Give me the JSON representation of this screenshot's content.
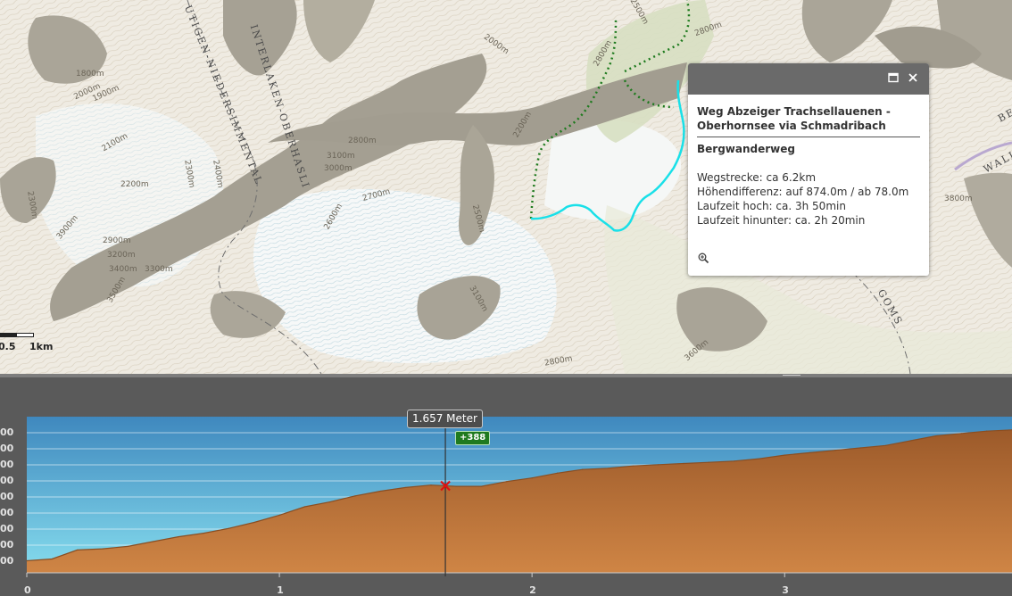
{
  "map": {
    "elevation_labels": [
      "1800m",
      "1900m",
      "2000m",
      "2100m",
      "2200m",
      "2300m",
      "2400m",
      "2600m",
      "2700m",
      "2800m",
      "2900m",
      "3000m",
      "3100m",
      "3200m",
      "3300m",
      "3400m",
      "3500m",
      "3600m",
      "3800m",
      "2800m",
      "2000m",
      "2200m",
      "2500m",
      "3100m",
      "2800m",
      "2500m",
      "2800m",
      "2300m",
      "3900m"
    ],
    "region_labels": {
      "niedersimmental": "UTIGEN-NIEDERSIMMENTAL",
      "oberhasli": "INTERLAKEN-OBERHASLI",
      "wallis": "WALLIS",
      "goms": "GOMS",
      "be": "BE"
    },
    "scalebar": {
      "label_left": "0.5",
      "label_right": "1km"
    },
    "colors": {
      "route_hike": "#19e0e8",
      "route_path": "#1d7a1d",
      "rock": "#a49f92"
    }
  },
  "popup": {
    "title": "Weg Abzeiger Trachsellauenen - Oberhornsee via Schmadribach",
    "type": "Bergwanderweg",
    "wegstrecke": "Wegstrecke: ca 6.2km",
    "hoehendifferenz": "Höhendifferenz: auf 874.0m / ab 78.0m",
    "laufzeit_hoch": "Laufzeit hoch: ca. 3h 50min",
    "laufzeit_hinunter": "Laufzeit hinunter: ca. 2h 20min",
    "maximize_icon": "maximize-icon",
    "close_icon": "close-icon",
    "zoom_icon": "zoom-in-icon"
  },
  "profile": {
    "distance_label": "1.657 Meter",
    "gain_label": "+388",
    "y_tick_labels": [
      "00",
      "00",
      "00",
      "00",
      "00",
      "00",
      "00",
      "00",
      "00",
      "00"
    ],
    "x_tick_labels": [
      "0",
      "1",
      "2",
      "3"
    ]
  },
  "chart_data": {
    "type": "area",
    "title": "",
    "xlabel": "",
    "ylabel": "",
    "x": [
      0,
      0.1,
      0.2,
      0.3,
      0.4,
      0.5,
      0.6,
      0.7,
      0.8,
      0.9,
      1.0,
      1.1,
      1.2,
      1.3,
      1.4,
      1.5,
      1.6,
      1.7,
      1.8,
      1.9,
      2.0,
      2.1,
      2.2,
      2.3,
      2.4,
      2.5,
      2.6,
      2.7,
      2.8,
      2.9,
      3.0,
      3.1,
      3.2,
      3.3,
      3.4,
      3.5,
      3.6,
      3.7,
      3.8,
      3.9
    ],
    "series": [
      {
        "values": [
          1.0,
          1.15,
          1.9,
          2.0,
          2.2,
          2.6,
          3.0,
          3.3,
          3.7,
          4.2,
          4.8,
          5.5,
          5.9,
          6.4,
          6.8,
          7.1,
          7.3,
          7.2,
          7.2,
          7.6,
          7.9,
          8.3,
          8.6,
          8.7,
          8.9,
          9.0,
          9.1,
          9.2,
          9.3,
          9.5,
          9.8,
          10.0,
          10.2,
          10.4,
          10.6,
          11.0,
          11.4,
          11.6,
          11.8,
          11.9
        ]
      }
    ],
    "xlim": [
      0,
      3.9
    ],
    "ylim": [
      0,
      13
    ],
    "marker_x": 1.657,
    "area_color": "#c0773a",
    "sky_color_top": "#3f88be",
    "sky_color_bottom": "#86ddee",
    "grid": true
  }
}
